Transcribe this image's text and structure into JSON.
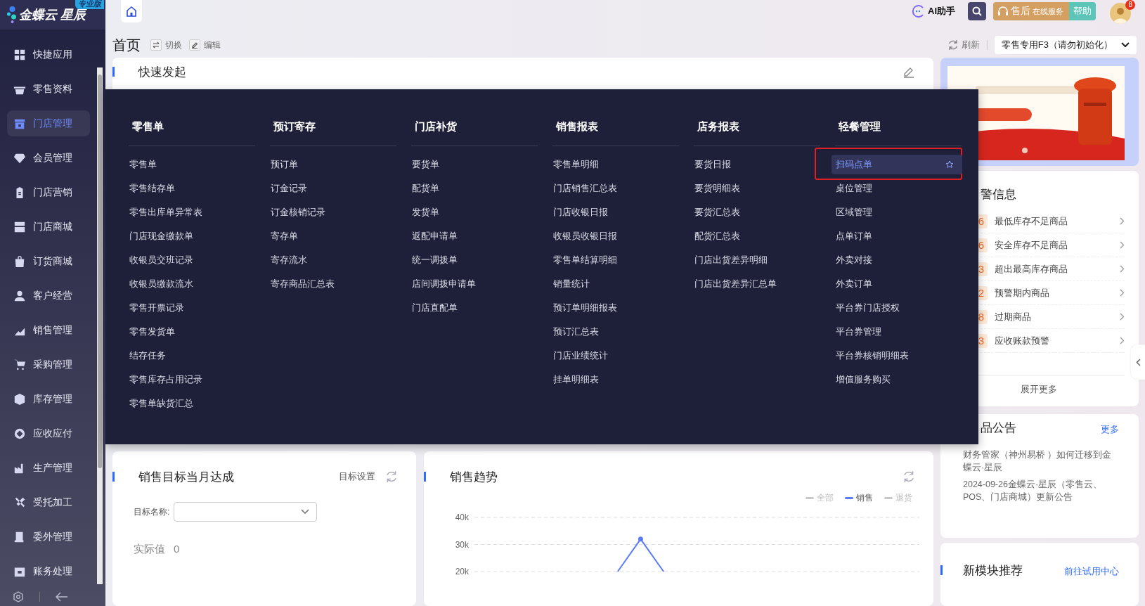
{
  "sidebar": {
    "brand": "金蝶云 星辰",
    "edition": "专业版",
    "items": [
      {
        "label": "快捷应用",
        "selected": false
      },
      {
        "label": "零售资料",
        "selected": false
      },
      {
        "label": "门店管理",
        "selected": true
      },
      {
        "label": "会员管理",
        "selected": false
      },
      {
        "label": "门店营销",
        "selected": false
      },
      {
        "label": "门店商城",
        "selected": false
      },
      {
        "label": "订货商城",
        "selected": false
      },
      {
        "label": "客户经营",
        "selected": false
      },
      {
        "label": "销售管理",
        "selected": false
      },
      {
        "label": "采购管理",
        "selected": false
      },
      {
        "label": "库存管理",
        "selected": false
      },
      {
        "label": "应收应付",
        "selected": false
      },
      {
        "label": "生产管理",
        "selected": false
      },
      {
        "label": "受托加工",
        "selected": false
      },
      {
        "label": "委外管理",
        "selected": false
      },
      {
        "label": "账务处理",
        "selected": false
      }
    ]
  },
  "top_bar": {
    "ai_assistant": "AI助手",
    "after_sales": "售后",
    "after_sales_sub": "在线服务",
    "help": "帮助",
    "notification_count": "8"
  },
  "page_header": {
    "title": "首页",
    "actions": [
      "切换",
      "编辑"
    ],
    "refresh": "刷新",
    "account": "零售专用F3（请勿初始化）"
  },
  "quick_launch": {
    "title": "快速发起"
  },
  "menu": {
    "columns": [
      {
        "heading": "零售单",
        "items": [
          {
            "label": "零售单",
            "selected": false
          },
          {
            "label": "零售结存单",
            "selected": false
          },
          {
            "label": "零售出库单异常表",
            "selected": false
          },
          {
            "label": "门店现金缴款单",
            "selected": false
          },
          {
            "label": "收银员交班记录",
            "selected": false
          },
          {
            "label": "收银员缴款流水",
            "selected": false
          },
          {
            "label": "零售开票记录",
            "selected": false
          },
          {
            "label": "零售发货单",
            "selected": false
          },
          {
            "label": "结存任务",
            "selected": false
          },
          {
            "label": "零售库存占用记录",
            "selected": false
          },
          {
            "label": "零售单缺货汇总",
            "selected": false
          }
        ]
      },
      {
        "heading": "预订寄存",
        "items": [
          {
            "label": "预订单",
            "selected": false
          },
          {
            "label": "订金记录",
            "selected": false
          },
          {
            "label": "订金核销记录",
            "selected": false
          },
          {
            "label": "寄存单",
            "selected": false
          },
          {
            "label": "寄存流水",
            "selected": false
          },
          {
            "label": "寄存商品汇总表",
            "selected": false
          }
        ]
      },
      {
        "heading": "门店补货",
        "items": [
          {
            "label": "要货单",
            "selected": false
          },
          {
            "label": "配货单",
            "selected": false
          },
          {
            "label": "发货单",
            "selected": false
          },
          {
            "label": "返配申请单",
            "selected": false
          },
          {
            "label": "统一调拨单",
            "selected": false
          },
          {
            "label": "店间调拨申请单",
            "selected": false
          },
          {
            "label": "门店直配单",
            "selected": false
          }
        ]
      },
      {
        "heading": "销售报表",
        "items": [
          {
            "label": "零售单明细",
            "selected": false
          },
          {
            "label": "门店销售汇总表",
            "selected": false
          },
          {
            "label": "门店收银日报",
            "selected": false
          },
          {
            "label": "收银员收银日报",
            "selected": false
          },
          {
            "label": "零售单结算明细",
            "selected": false
          },
          {
            "label": "销量统计",
            "selected": false
          },
          {
            "label": "预订单明细报表",
            "selected": false
          },
          {
            "label": "预订汇总表",
            "selected": false
          },
          {
            "label": "门店业绩统计",
            "selected": false
          },
          {
            "label": "挂单明细表",
            "selected": false
          }
        ]
      },
      {
        "heading": "店务报表",
        "items": [
          {
            "label": "要货日报",
            "selected": false
          },
          {
            "label": "要货明细表",
            "selected": false
          },
          {
            "label": "要货汇总表",
            "selected": false
          },
          {
            "label": "配货汇总表",
            "selected": false
          },
          {
            "label": "门店出货差异明细",
            "selected": false
          },
          {
            "label": "门店出货差异汇总单",
            "selected": false
          }
        ]
      },
      {
        "heading": "轻餐管理",
        "items": [
          {
            "label": "扫码点单",
            "selected": true
          },
          {
            "label": "桌位管理",
            "selected": false
          },
          {
            "label": "区域管理",
            "selected": false
          },
          {
            "label": "点单订单",
            "selected": false
          },
          {
            "label": "外卖对接",
            "selected": false
          },
          {
            "label": "外卖订单",
            "selected": false
          },
          {
            "label": "平台券门店授权",
            "selected": false
          },
          {
            "label": "平台券管理",
            "selected": false
          },
          {
            "label": "平台券核销明细表",
            "selected": false
          },
          {
            "label": "增值服务购买",
            "selected": false
          }
        ]
      }
    ]
  },
  "sales_target": {
    "title": "销售目标当月达成",
    "settings_link": "目标设置",
    "field_label": "目标名称:",
    "actual_label": "实际值",
    "actual_value": "0"
  },
  "sales_trend": {
    "title": "销售趋势",
    "legend": [
      {
        "on": false
      },
      {
        "on": true
      },
      {
        "on": false
      }
    ],
    "chart_data": {
      "type": "line",
      "ylim": [
        20000,
        40000
      ],
      "yticks": [
        {
          "value": 20000,
          "label": "20k"
        },
        {
          "value": 30000,
          "label": "30k"
        },
        {
          "value": 40000,
          "label": "40k"
        }
      ],
      "series": [
        {
          "name": "全部",
          "color": "#c8c8c8",
          "values": [
            null,
            null,
            null,
            null,
            null,
            null,
            null,
            null,
            null,
            null,
            null,
            null,
            null,
            null,
            null,
            null,
            null,
            null,
            null,
            null
          ]
        },
        {
          "name": "销售",
          "color": "#5b7cf5",
          "values": [
            null,
            null,
            null,
            null,
            null,
            null,
            20000,
            32000,
            20000,
            null,
            null,
            null,
            null,
            null,
            null,
            null,
            null,
            null,
            null,
            null
          ]
        },
        {
          "name": "退货",
          "color": "#c8c8c8",
          "values": [
            null,
            null,
            null,
            null,
            null,
            null,
            null,
            null,
            null,
            null,
            null,
            null,
            null,
            null,
            null,
            null,
            null,
            null,
            null,
            null
          ]
        }
      ]
    }
  },
  "alerts": {
    "title": "警信息",
    "items": [
      {
        "count": "6",
        "label": "最低库存不足商品"
      },
      {
        "count": "6",
        "label": "安全库存不足商品"
      },
      {
        "count": "3",
        "label": "超出最高库存商品"
      },
      {
        "count": "2",
        "label": "预警期内商品"
      },
      {
        "count": "8",
        "label": "过期商品"
      },
      {
        "count": "3",
        "label": "应收账款预警"
      }
    ],
    "expand": "展开更多"
  },
  "announcements": {
    "title": "品公告",
    "more": "更多",
    "items": [
      "财务管家（神州易桥 ）如何迁移到金蝶云·星辰",
      "2024-09-26金蝶云·星辰（零售云、POS、门店商城）更新公告"
    ]
  },
  "new_modules": {
    "title": "新模块推荐",
    "link": "前往试用中心"
  }
}
